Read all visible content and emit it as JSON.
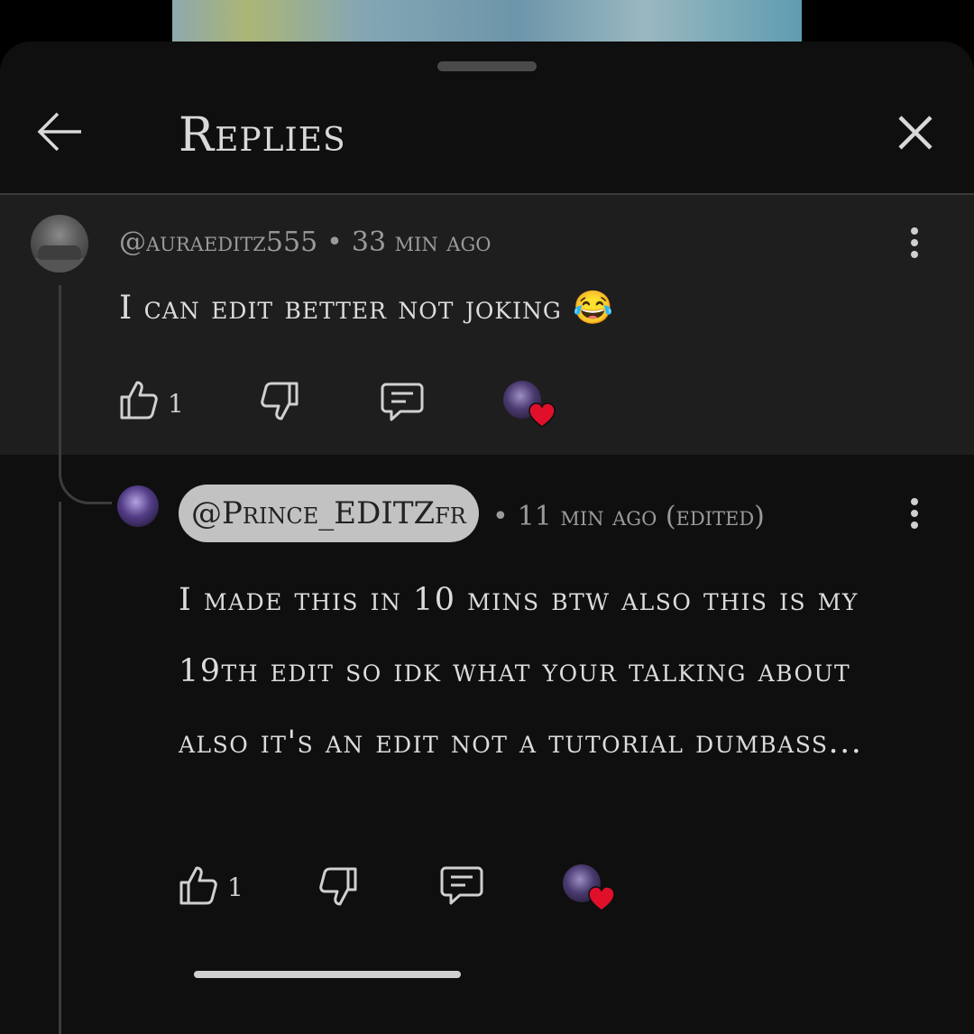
{
  "header": {
    "title": "Replies"
  },
  "parent_comment": {
    "author": "@auraeditz555",
    "time": "33 min ago",
    "text": "I can edit better not joking 😂",
    "likes": "1"
  },
  "reply": {
    "author": "@Prince_EDITZfr",
    "time": "11 min ago (edited)",
    "text": "I made this in 10 mins btw also this is my 19th edit so idk what your talking about also it's an edit not a tutorial dumbass...",
    "likes": "1"
  },
  "colors": {
    "sheet_bg": "#0f0f0f",
    "highlight_bg": "#1e1e1e",
    "heart": "#e0102a",
    "pill_bg": "#c2c2c2"
  },
  "icons": [
    "back-arrow-icon",
    "close-icon",
    "more-vert-icon",
    "thumbs-up-icon",
    "thumbs-down-icon",
    "reply-icon",
    "heart-icon"
  ]
}
